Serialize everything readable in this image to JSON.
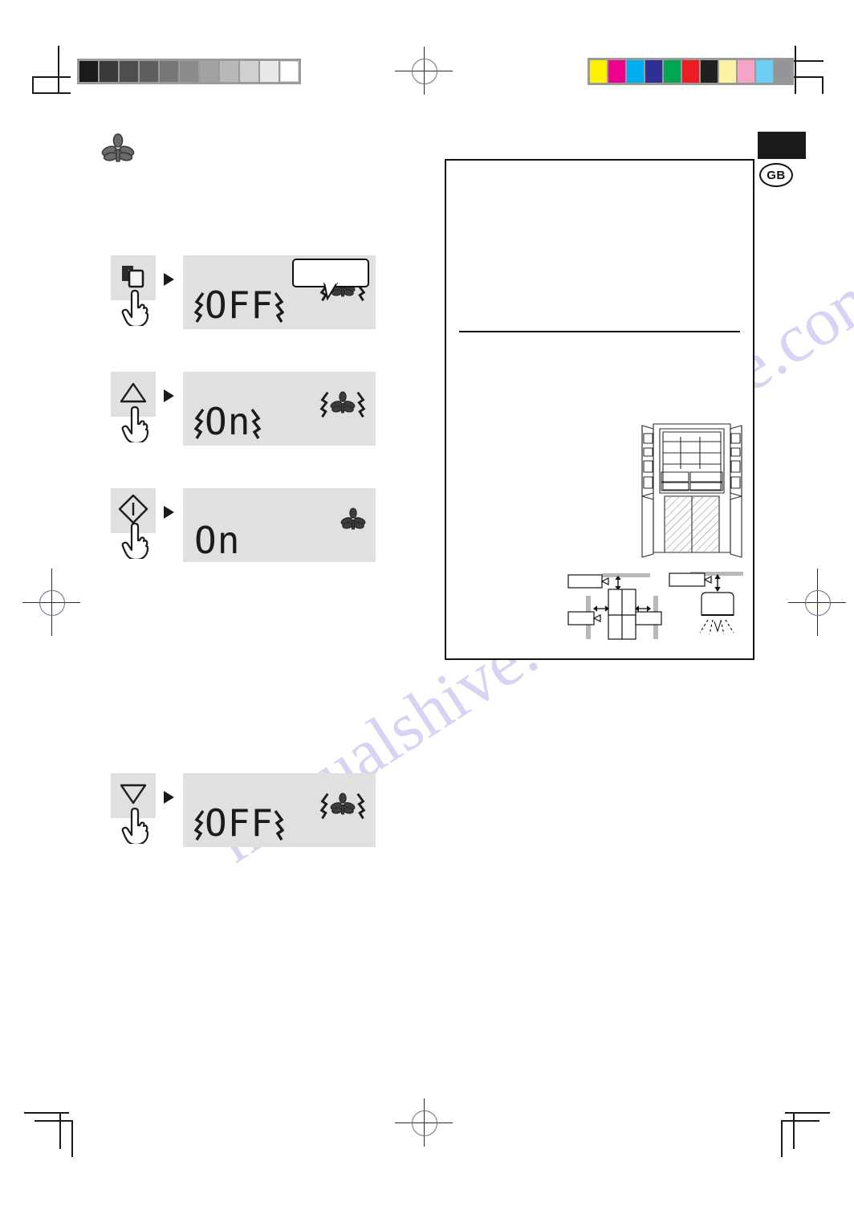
{
  "page": {
    "language_badge": "GB",
    "watermark": "manualshive.com"
  },
  "calibration": {
    "grayscale_label": "grayscale-density-strip",
    "grayscale_swatches": [
      "#1a1a1a",
      "#3a3a3a",
      "#4e4e4e",
      "#5e5e5e",
      "#767676",
      "#8c8c8c",
      "#a2a2a2",
      "#b8b8b8",
      "#d0d0d0",
      "#e8e8e8",
      "#ffffff"
    ],
    "color_label": "color-density-strip",
    "color_swatches": [
      "#fff200",
      "#ec008c",
      "#00aeef",
      "#2e3192",
      "#00a651",
      "#ed1c24",
      "#221f1f",
      "#fbf3a3",
      "#f5a4c8",
      "#6dcff6",
      "#939598"
    ]
  },
  "section": {
    "icon": "leaf-icon"
  },
  "steps": [
    {
      "id": "step-mode",
      "button_icon": "mode-copy-icon",
      "pointer_icon": "hand-pointer-icon",
      "arrow_icon": "play-arrow-icon",
      "display_value": "OFF",
      "display_flashing": true,
      "status_icon": "leaf-icon",
      "status_flashing": true,
      "callout_text": "",
      "has_callout": true
    },
    {
      "id": "step-up",
      "button_icon": "triangle-up-icon",
      "pointer_icon": "hand-pointer-icon",
      "arrow_icon": "play-arrow-icon",
      "display_value": "On",
      "display_flashing": true,
      "status_icon": "leaf-icon",
      "status_flashing": true,
      "callout_text": "",
      "has_callout": false
    },
    {
      "id": "step-set",
      "button_icon": "diamond-power-icon",
      "pointer_icon": "hand-pointer-icon",
      "arrow_icon": "play-arrow-icon",
      "display_value": "On",
      "display_flashing": false,
      "status_icon": "leaf-icon",
      "status_flashing": false,
      "callout_text": "",
      "has_callout": false
    },
    {
      "id": "step-down",
      "button_icon": "triangle-down-icon",
      "pointer_icon": "hand-pointer-icon",
      "arrow_icon": "play-arrow-icon",
      "display_value": "OFF",
      "display_flashing": true,
      "status_icon": "leaf-icon",
      "status_flashing": true,
      "callout_text": "",
      "has_callout": false
    }
  ],
  "info_panel": {
    "title": "",
    "body": "",
    "figure_refrigerator": "refrigerator-open-doors-diagram",
    "figure_clearance_top": "clearance-top-side-diagram",
    "figure_clearance_side": "clearance-rear-diagram"
  },
  "print_marks": {
    "registration_icon": "registration-target-icon",
    "crop_icon": "crop-mark-icon"
  }
}
